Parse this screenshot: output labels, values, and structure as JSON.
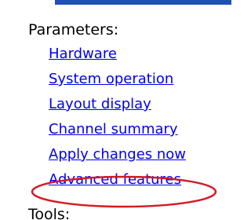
{
  "parameters": {
    "heading": "Parameters:",
    "links": [
      {
        "label": "Hardware"
      },
      {
        "label": "System operation"
      },
      {
        "label": "Layout display"
      },
      {
        "label": "Channel summary"
      },
      {
        "label": "Apply changes now"
      },
      {
        "label": "Advanced features"
      }
    ]
  },
  "tools": {
    "heading": "Tools:"
  },
  "highlight": {
    "target": "Advanced features",
    "color": "#d41b24"
  },
  "colors": {
    "link": "#0000ee",
    "accent_bar": "#1f4fb8"
  }
}
